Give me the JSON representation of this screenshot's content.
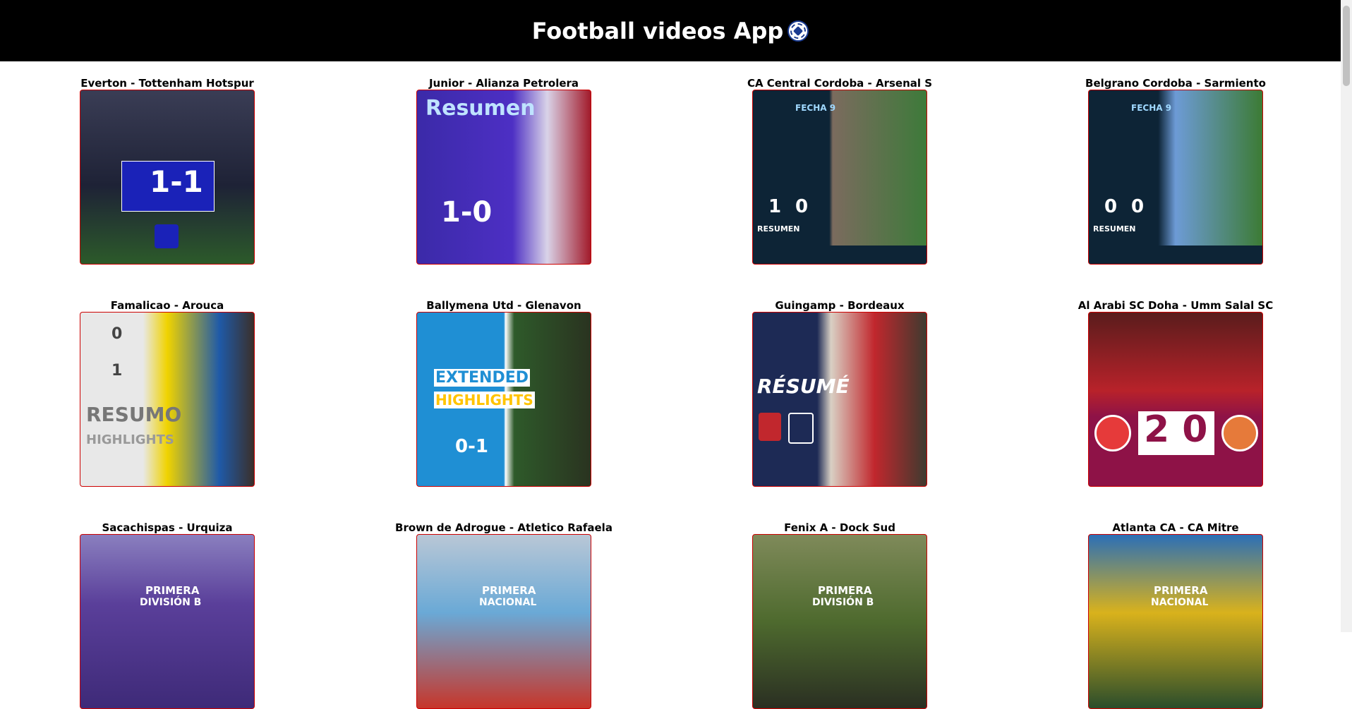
{
  "app": {
    "title": "Football videos App",
    "title_icon": "soccer-ball-icon"
  },
  "videos": [
    {
      "title": "Everton - Tottenham Hotspur",
      "score": "1-1",
      "thumb_color": "#2c2f6b"
    },
    {
      "title": "Junior - Alianza Petrolera",
      "banner": "Resumen",
      "score": "1-0",
      "thumb_color": "#3b2aa8"
    },
    {
      "title": "CA Central Cordoba - Arsenal S",
      "banner": "FECHA 9",
      "score_home": "1",
      "score_away": "0",
      "footer": "RESUMEN",
      "thumb_color": "#0d2436"
    },
    {
      "title": "Belgrano Cordoba - Sarmiento",
      "banner": "FECHA 9",
      "score_home": "0",
      "score_away": "0",
      "footer": "RESUMEN",
      "thumb_color": "#0d2436"
    },
    {
      "title": "Famalicao - Arouca",
      "banner": "RESUMO",
      "sub": "HIGHLIGHTS",
      "score_home": "0",
      "score_away": "1",
      "thumb_color": "#e8e8e8"
    },
    {
      "title": "Ballymena Utd - Glenavon",
      "banner": "EXTENDED",
      "sub": "HIGHLIGHTS",
      "score": "0-1",
      "thumb_color": "#1f8fd4"
    },
    {
      "title": "Guingamp - Bordeaux",
      "banner": "RÉSUMÉ",
      "thumb_color": "#1d2a55"
    },
    {
      "title": "Al Arabi SC Doha - Umm Salal SC",
      "score": "2 0",
      "thumb_color": "#c8102e"
    },
    {
      "title": "Sacachispas - Urquiza",
      "banner": "PRIMERA",
      "sub": "DIVISIÓN B",
      "thumb_color": "#5a3f9a"
    },
    {
      "title": "Brown de Adrogue - Atletico Rafaela",
      "banner": "PRIMERA",
      "sub": "NACIONAL",
      "thumb_color": "#6aa9d6"
    },
    {
      "title": "Fenix A - Dock Sud",
      "banner": "PRIMERA",
      "sub": "DIVISIÓN B",
      "thumb_color": "#4e6a2e"
    },
    {
      "title": "Atlanta CA - CA Mitre",
      "banner": "PRIMERA",
      "sub": "NACIONAL",
      "thumb_color": "#d9b21c"
    }
  ]
}
